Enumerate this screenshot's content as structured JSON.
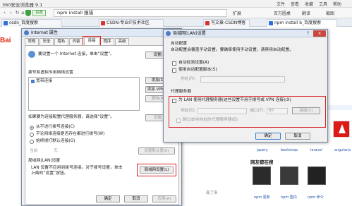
{
  "browser": {
    "title": "360安全浏览器 9.1",
    "menu": [
      "文件",
      "查看",
      "收藏",
      "工具",
      "帮助"
    ],
    "nav": {
      "back": "‹",
      "forward": "›",
      "refresh": "↻",
      "home": "⌂"
    },
    "site_badge": "百度",
    "url": "npm install 报错",
    "addr_tools": [
      "扩展",
      "百万圆桌",
      "翻译",
      "截图"
    ],
    "tabs": [
      {
        "label": "csdn_百度搜索",
        "color": "#2f6fd6"
      },
      {
        "label": "CSDN-专业IT技术社区",
        "color": "#d9332a"
      },
      {
        "label": "写文章-CSDN博客",
        "color": "#d9332a"
      },
      {
        "label": "npm install b_百度搜索",
        "color": "#2f6fd6"
      }
    ]
  },
  "page": {
    "logo": "Bai",
    "thumb_labels": [
      "jquery",
      "bootstrap",
      "laravel",
      "angularjs"
    ],
    "section_title": "网友都在搜",
    "bottom_labels": [
      "npm 更新",
      "npm 国内",
      "npm 命令"
    ],
    "cut_text": "现了多"
  },
  "internet_props": {
    "title": "Internet 属性",
    "tabs": [
      "常规",
      "安全",
      "隐私",
      "内容",
      "连接",
      "程序",
      "高级"
    ],
    "active_tab": 4,
    "setup_text": "要设置一个 Internet 连接，单击“设置”。",
    "setup_btn": "设置(U)",
    "dialup_heading": "拨号和虚拟专用网络设置",
    "connections": [
      "宽带连接"
    ],
    "add_btn": "添加(D)...",
    "add_vpn_btn": "添加 VPN(P)...",
    "delete_btn": "删除(R)...",
    "proxy_note": "如果要为连接配置代理服务器，请选择“设置”。",
    "settings_btn": "设置(S)",
    "radios": [
      "从不进行拨号连接(C)",
      "不论网络连接是否存在都进行拨号(W)",
      "始终拨打默认连接(O)"
    ],
    "current_label": "当前",
    "current_value": "无",
    "set_default_btn": "设置默认值(E)",
    "lan_heading": "局域网(LAN)设置",
    "lan_text_1": "LAN 设置不应用到拨号连接。对于拨号设置，单击",
    "lan_text_2": "上面的“设置”按钮。",
    "lan_btn": "局域网设置(L)",
    "ok": "确定",
    "cancel": "取消",
    "apply": "应用(A)"
  },
  "lan_dialog": {
    "title": "局域网(LAN)设置",
    "help": "?",
    "close": "×",
    "auto_heading": "自动配置",
    "auto_desc": "自动配置会覆盖手动设置。要确保使用手动设置，请禁用自动配置。",
    "auto_detect": "自动检测设置(A)",
    "use_script": "使用自动配置脚本(S)",
    "address_label": "地址(R)",
    "proxy_heading": "代理服务器",
    "proxy_check": "为 LAN 使用代理服务器(这些设置不用于拨号或 VPN 连接)(X)",
    "addr_label": "地址(E):",
    "port_label": "端口(T):",
    "port_value": "80",
    "advanced_btn": "高级(C)",
    "bypass_label": "跳过本地地址的代理服务器(B)",
    "ok": "确定",
    "cancel": "取消"
  },
  "colors": {
    "highlight": "#d92020",
    "accent": "#3c7fd1"
  }
}
